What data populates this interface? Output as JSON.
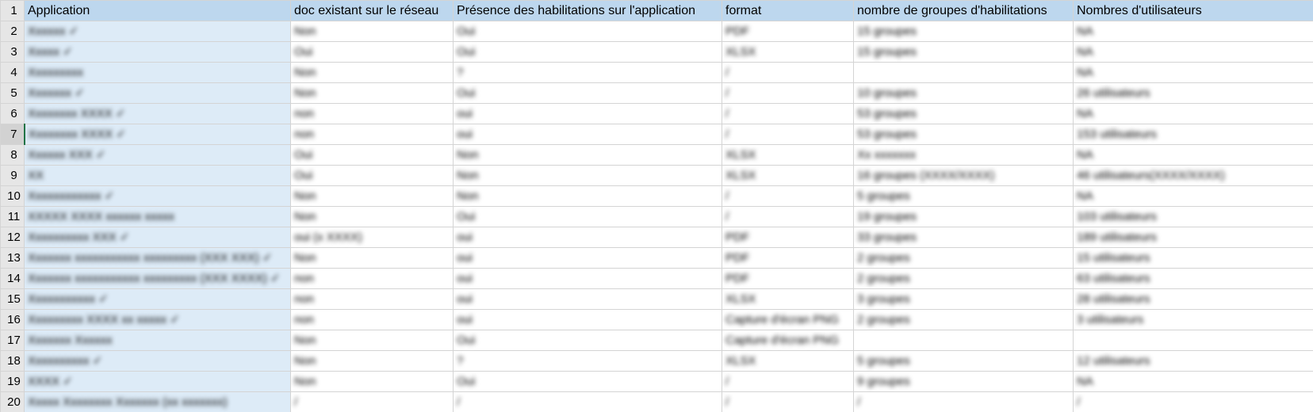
{
  "columns": [
    "Application",
    "doc existant sur le réseau",
    "Présence des habilitations sur l'application",
    "format",
    "nombre de groupes d'habilitations",
    "Nombres d'utilisateurs"
  ],
  "header_row_number": "1",
  "rows": [
    {
      "num": "2",
      "cells": [
        "Xxxxxx ✓",
        "Non",
        "Oui",
        "PDF",
        "15 groupes",
        "NA"
      ]
    },
    {
      "num": "3",
      "cells": [
        "Xxxxx ✓",
        "Oui",
        "Oui",
        "XLSX",
        "15 groupes",
        "NA"
      ]
    },
    {
      "num": "4",
      "cells": [
        "Xxxxxxxxx",
        "Non",
        "?",
        "/",
        "",
        "NA"
      ]
    },
    {
      "num": "5",
      "cells": [
        "Xxxxxxx ✓",
        "Non",
        "Oui",
        "/",
        "10 groupes",
        "26 utilisateurs"
      ]
    },
    {
      "num": "6",
      "cells": [
        "Xxxxxxxx XXXX ✓",
        "non",
        "oui",
        "/",
        "53 groupes",
        "NA"
      ]
    },
    {
      "num": "7",
      "cells": [
        "Xxxxxxxx XXXX ✓",
        "non",
        "oui",
        "/",
        "53 groupes",
        "153 utilisateurs"
      ]
    },
    {
      "num": "8",
      "cells": [
        "Xxxxxx XXX ✓",
        "Oui",
        "Non",
        "XLSX",
        "Xx xxxxxxx",
        "NA"
      ]
    },
    {
      "num": "9",
      "cells": [
        "XX",
        "Oui",
        "Non",
        "XLSX",
        "16 groupes (XXXX/XXXX)",
        "46 utilisateurs(XXXX/XXXX)"
      ]
    },
    {
      "num": "10",
      "cells": [
        "Xxxxxxxxxxxx ✓",
        "Non",
        "Non",
        "/",
        "5 groupes",
        "NA"
      ]
    },
    {
      "num": "11",
      "cells": [
        "XXXXX XXXX xxxxxx xxxxx",
        "Non",
        "Oui",
        "/",
        "19 groupes",
        "103 utilisateurs"
      ]
    },
    {
      "num": "12",
      "cells": [
        "Xxxxxxxxxx XXX ✓",
        "oui (x XXXX)",
        "oui",
        "PDF",
        "33 groupes",
        "189 utilisateurs"
      ]
    },
    {
      "num": "13",
      "cells": [
        "Xxxxxxx xxxxxxxxxxx xxxxxxxxx (XXX XXX) ✓",
        "Non",
        "oui",
        "PDF",
        "2 groupes",
        "15 utilisateurs"
      ]
    },
    {
      "num": "14",
      "cells": [
        "Xxxxxxx xxxxxxxxxxx xxxxxxxxx (XXX XXXX) ✓",
        "non",
        "oui",
        "PDF",
        "2 groupes",
        "63 utilisateurs"
      ]
    },
    {
      "num": "15",
      "cells": [
        "Xxxxxxxxxxx ✓",
        "non",
        "oui",
        "XLSX",
        "3 groupes",
        "28 utilisateurs"
      ]
    },
    {
      "num": "16",
      "cells": [
        "Xxxxxxxxx XXXX xx xxxxx ✓",
        "non",
        "oui",
        "Capture d'écran PNG",
        "2 groupes",
        "3 utilisateurs"
      ]
    },
    {
      "num": "17",
      "cells": [
        "Xxxxxxx Xxxxxx",
        "Non",
        "Oui",
        "Capture d'écran PNG",
        "",
        ""
      ]
    },
    {
      "num": "18",
      "cells": [
        "Xxxxxxxxxx ✓",
        "Non",
        "?",
        "XLSX",
        "5 groupes",
        "12 utilisateurs"
      ]
    },
    {
      "num": "19",
      "cells": [
        "XXXX ✓",
        "Non",
        "Oui",
        "/",
        "9 groupes",
        "NA"
      ]
    },
    {
      "num": "20",
      "cells": [
        "Xxxxx Xxxxxxxx Xxxxxxx (xx xxxxxxx)",
        "/",
        "/",
        "/",
        "/",
        "/"
      ]
    }
  ],
  "selected_row": "7",
  "colors": {
    "header_fill": "#bdd7ee",
    "application_fill": "#ddebf7",
    "row_header_fill": "#e6e6e6",
    "selection_accent": "#217346"
  }
}
